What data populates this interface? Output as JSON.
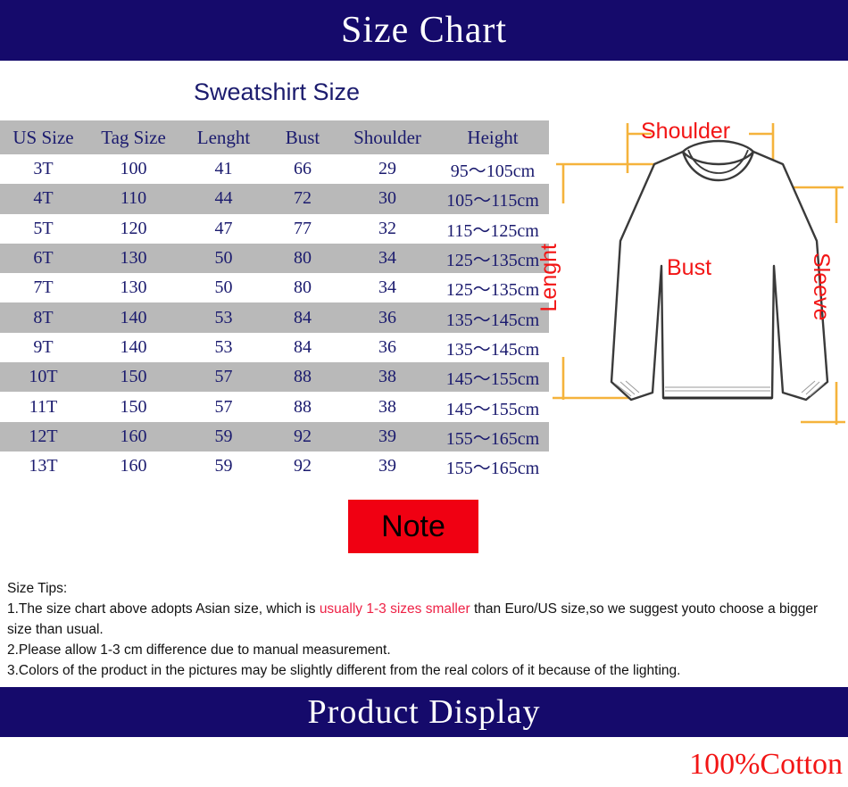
{
  "banners": {
    "top_title": "Size Chart",
    "bottom_title": "Product Display"
  },
  "section": {
    "title": "Sweatshirt Size"
  },
  "table": {
    "columns": [
      "US Size",
      "Tag Size",
      "Lenght",
      "Bust",
      "Shoulder",
      "Height"
    ],
    "rows": [
      [
        "3T",
        "100",
        "41",
        "66",
        "29",
        "95～105cm"
      ],
      [
        "4T",
        "110",
        "44",
        "72",
        "30",
        "105～115cm"
      ],
      [
        "5T",
        "120",
        "47",
        "77",
        "32",
        "115～125cm"
      ],
      [
        "6T",
        "130",
        "50",
        "80",
        "34",
        "125～135cm"
      ],
      [
        "7T",
        "130",
        "50",
        "80",
        "34",
        "125～135cm"
      ],
      [
        "8T",
        "140",
        "53",
        "84",
        "36",
        "135～145cm"
      ],
      [
        "9T",
        "140",
        "53",
        "84",
        "36",
        "135～145cm"
      ],
      [
        "10T",
        "150",
        "57",
        "88",
        "38",
        "145～155cm"
      ],
      [
        "11T",
        "150",
        "57",
        "88",
        "38",
        "145～155cm"
      ],
      [
        "12T",
        "160",
        "59",
        "92",
        "39",
        "155～165cm"
      ],
      [
        "13T",
        "160",
        "59",
        "92",
        "39",
        "155～165cm"
      ]
    ]
  },
  "diagram": {
    "labels": {
      "shoulder": "Shoulder",
      "bust": "Bust",
      "lenght": "Lenght",
      "sleeve": "Sleeve"
    },
    "colors": {
      "label": "#f21515",
      "arrow": "#f5b33c",
      "outline": "#3a3a3a"
    }
  },
  "note": {
    "label": "Note",
    "box_color": "#f00012"
  },
  "tips": {
    "heading": "Size Tips:",
    "line1_part1": "1.The size chart above adopts Asian size, which is",
    "line1_highlight": "usually 1-3 sizes smaller",
    "line1_part2": "than Euro/US size,so we suggest youto choose a bigger size than usual.",
    "line2": "2.Please allow 1-3 cm difference due to manual measurement.",
    "line3": "3.Colors of the product in the pictures may be slightly different from the real colors of it because of the lighting."
  },
  "footer": {
    "cotton": "100%Cotton"
  },
  "theme": {
    "navy": "#150a6b",
    "table_gray": "#b9b9b9",
    "text_navy": "#1a1a6e",
    "red": "#f21515"
  }
}
